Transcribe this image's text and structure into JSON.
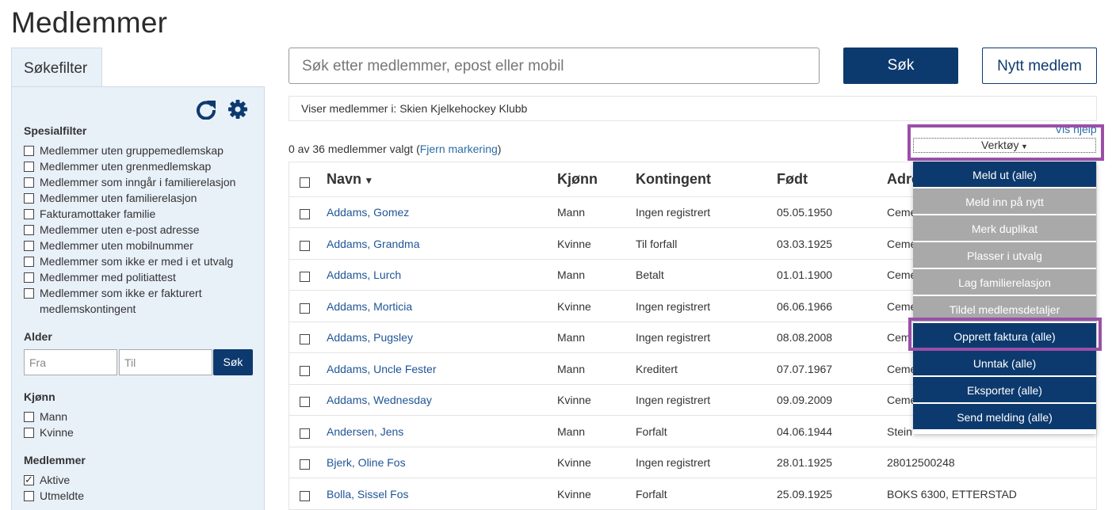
{
  "page": {
    "title": "Medlemmer"
  },
  "sidebar": {
    "tab_label": "Søkefilter",
    "icons": {
      "refresh": "refresh-icon",
      "settings": "gear-icon"
    },
    "special_heading": "Spesialfilter",
    "special_filters": [
      {
        "label": "Medlemmer uten gruppemedlemskap",
        "checked": false
      },
      {
        "label": "Medlemmer uten grenmedlemskap",
        "checked": false
      },
      {
        "label": "Medlemmer som inngår i familierelasjon",
        "checked": false
      },
      {
        "label": "Medlemmer uten familierelasjon",
        "checked": false
      },
      {
        "label": "Fakturamottaker familie",
        "checked": false
      },
      {
        "label": "Medlemmer uten e-post adresse",
        "checked": false
      },
      {
        "label": "Medlemmer uten mobilnummer",
        "checked": false
      },
      {
        "label": "Medlemmer som ikke er med i et utvalg",
        "checked": false
      },
      {
        "label": "Medlemmer med politiattest",
        "checked": false
      },
      {
        "label": "Medlemmer som ikke er fakturert medlemskontingent",
        "checked": false
      }
    ],
    "age_heading": "Alder",
    "age_from_placeholder": "Fra",
    "age_to_placeholder": "Til",
    "age_search_label": "Søk",
    "gender_heading": "Kjønn",
    "gender_filters": [
      {
        "label": "Mann",
        "checked": false
      },
      {
        "label": "Kvinne",
        "checked": false
      }
    ],
    "members_heading": "Medlemmer",
    "member_filters": [
      {
        "label": "Aktive",
        "checked": true
      },
      {
        "label": "Utmeldte",
        "checked": false
      }
    ]
  },
  "search": {
    "placeholder": "Søk etter medlemmer, epost eller mobil",
    "search_label": "Søk",
    "new_member_label": "Nytt medlem"
  },
  "info": {
    "text": "Viser medlemmer i: Skien Kjelkehockey Klubb"
  },
  "selection": {
    "text": "0 av 36 medlemmer valgt (",
    "clear_link": "Fjern markering",
    "close_paren": ")"
  },
  "help_link": "Vis hjelp",
  "tools": {
    "label": "Verktøy",
    "items": [
      {
        "label": "Meld ut (alle)",
        "state": "active"
      },
      {
        "label": "Meld inn på nytt",
        "state": "disabled"
      },
      {
        "label": "Merk duplikat",
        "state": "disabled"
      },
      {
        "label": "Plasser i utvalg",
        "state": "disabled"
      },
      {
        "label": "Lag familierelasjon",
        "state": "disabled"
      },
      {
        "label": "Tildel medlemsdetaljer",
        "state": "disabled"
      },
      {
        "label": "Opprett faktura (alle)",
        "state": "active"
      },
      {
        "label": "Unntak (alle)",
        "state": "active"
      },
      {
        "label": "Eksporter (alle)",
        "state": "active"
      },
      {
        "label": "Send melding (alle)",
        "state": "active"
      }
    ],
    "highlight_color": "#9b4fa8"
  },
  "table": {
    "columns": [
      "Navn",
      "Kjønn",
      "Kontingent",
      "Født",
      "Adre"
    ],
    "rows": [
      {
        "name": "Addams, Gomez",
        "gender": "Mann",
        "fee": "Ingen registrert",
        "born": "05.05.1950",
        "address": "Ceme"
      },
      {
        "name": "Addams, Grandma",
        "gender": "Kvinne",
        "fee": "Til forfall",
        "born": "03.03.1925",
        "address": "Ceme"
      },
      {
        "name": "Addams, Lurch",
        "gender": "Mann",
        "fee": "Betalt",
        "born": "01.01.1900",
        "address": "Ceme"
      },
      {
        "name": "Addams, Morticia",
        "gender": "Kvinne",
        "fee": "Ingen registrert",
        "born": "06.06.1966",
        "address": "Ceme"
      },
      {
        "name": "Addams, Pugsley",
        "gender": "Mann",
        "fee": "Ingen registrert",
        "born": "08.08.2008",
        "address": "Cem"
      },
      {
        "name": "Addams, Uncle Fester",
        "gender": "Mann",
        "fee": "Kreditert",
        "born": "07.07.1967",
        "address": "Ceme"
      },
      {
        "name": "Addams, Wednesday",
        "gender": "Kvinne",
        "fee": "Ingen registrert",
        "born": "09.09.2009",
        "address": "Ceme"
      },
      {
        "name": "Andersen, Jens",
        "gender": "Mann",
        "fee": "Forfalt",
        "born": "04.06.1944",
        "address": "Stein"
      },
      {
        "name": "Bjerk, Oline Fos",
        "gender": "Kvinne",
        "fee": "Ingen registrert",
        "born": "28.01.1925",
        "address": "28012500248"
      },
      {
        "name": "Bolla, Sissel Fos",
        "gender": "Kvinne",
        "fee": "Forfalt",
        "born": "25.09.1925",
        "address": "BOKS 6300, ETTERSTAD"
      }
    ]
  },
  "colors": {
    "primary": "#0d3a6e",
    "link": "#2a6da8",
    "panel": "#e8f0f8",
    "disabled": "#a9a9a9"
  }
}
